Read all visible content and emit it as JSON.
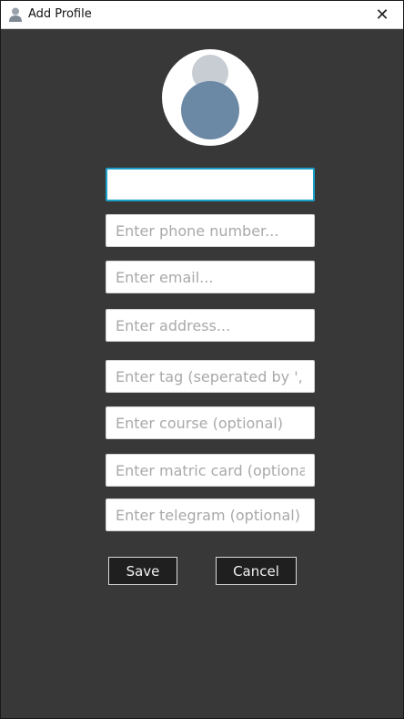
{
  "window": {
    "title": "Add Profile",
    "close_glyph": "✕"
  },
  "avatar": {
    "icon": "person-avatar-icon"
  },
  "form": {
    "name": {
      "value": "",
      "placeholder": ""
    },
    "phone": {
      "value": "",
      "placeholder": "Enter phone number..."
    },
    "email": {
      "value": "",
      "placeholder": "Enter email..."
    },
    "address": {
      "value": "",
      "placeholder": "Enter address..."
    },
    "tag": {
      "value": "",
      "placeholder": "Enter tag (seperated by ', ')"
    },
    "course": {
      "value": "",
      "placeholder": "Enter course (optional)"
    },
    "matric": {
      "value": "",
      "placeholder": "Enter matric card (optional)"
    },
    "telegram": {
      "value": "",
      "placeholder": "Enter telegram (optional)"
    }
  },
  "buttons": {
    "save_label": "Save",
    "cancel_label": "Cancel"
  },
  "colors": {
    "background": "#383838",
    "focus_border": "#1aa0c8",
    "avatar_head": "#c8cdd4",
    "avatar_body": "#6b88a5",
    "button_bg": "#1f1f1f"
  }
}
